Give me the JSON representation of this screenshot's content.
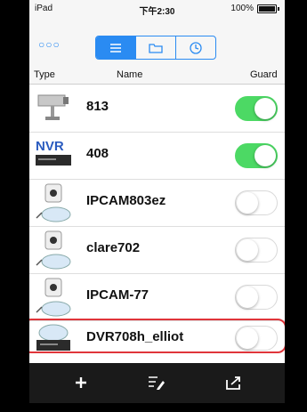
{
  "status": {
    "device": "iPad",
    "time": "下午2:30",
    "battery": "100%"
  },
  "toolbar": {
    "more_icon": "ellipsis-icon",
    "segments": [
      "list-icon",
      "folder-icon",
      "clock-icon"
    ]
  },
  "table": {
    "headers": {
      "type": "Type",
      "name": "Name",
      "guard": "Guard"
    },
    "rows": [
      {
        "name": "813",
        "icon": "camera-icon",
        "guard": true
      },
      {
        "name": "408",
        "icon": "nvr-icon",
        "guard": true
      },
      {
        "name": "IPCAM803ez",
        "icon": "ipcam-icon",
        "guard": false
      },
      {
        "name": "clare702",
        "icon": "ipcam-icon",
        "guard": false
      },
      {
        "name": "IPCAM-77",
        "icon": "ipcam-icon",
        "guard": false
      },
      {
        "name": "DVR708h_elliot",
        "icon": "dvr-icon",
        "guard": false
      }
    ]
  },
  "bottom": {
    "buttons": [
      "add-icon",
      "edit-list-icon",
      "share-icon"
    ]
  }
}
